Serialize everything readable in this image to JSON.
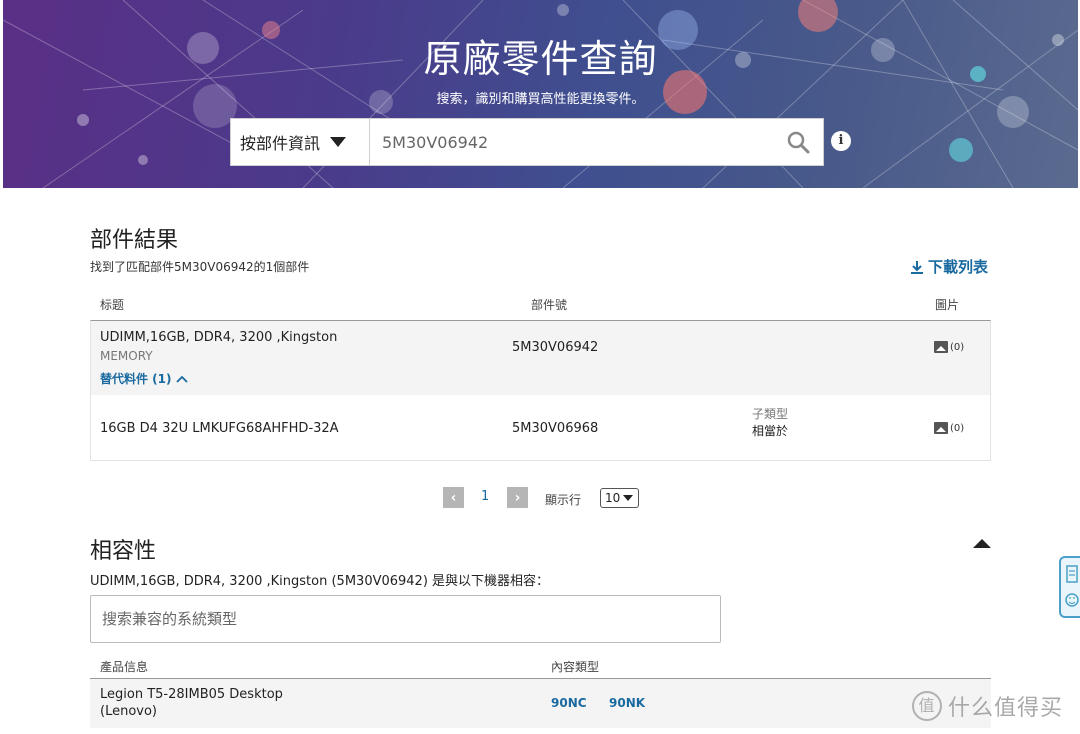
{
  "hero": {
    "title": "原廠零件查詢",
    "subtitle": "搜索，識別和購買高性能更換零件。",
    "search_mode": "按部件資訊",
    "search_value": "5M30V06942",
    "info_symbol": "i"
  },
  "results": {
    "title": "部件結果",
    "summary": "找到了匹配部件5M30V06942的1個部件",
    "download_label": "下載列表",
    "columns": {
      "title": "标题",
      "part_number": "部件號",
      "image": "圖片"
    },
    "rows": [
      {
        "title": "UDIMM,16GB, DDR4, 3200 ,Kingston",
        "category": "MEMORY",
        "alt_label": "替代料件 (1)",
        "part_number": "5M30V06942",
        "image_count": "(0)"
      },
      {
        "title": "16GB D4 32U LMKUFG68AHFHD-32A",
        "part_number": "5M30V06968",
        "subtype_label": "子類型",
        "subtype_value": "相當於",
        "image_count": "(0)"
      }
    ]
  },
  "pagination": {
    "prev": "‹",
    "current_page": "1",
    "next": "›",
    "rows_label": "顯示行",
    "rows_value": "10"
  },
  "compatibility": {
    "title": "相容性",
    "description": "UDIMM,16GB, DDR4, 3200 ,Kingston (5M30V06942) 是與以下機器相容：",
    "search_placeholder": "搜索兼容的系統類型",
    "columns": {
      "product": "產品信息",
      "content_type": "內容類型"
    },
    "rows": [
      {
        "product_line1": "Legion T5-28IMB05 Desktop",
        "product_line2": "(Lenovo)",
        "codes": [
          "90NC",
          "90NK"
        ]
      }
    ]
  },
  "watermark": {
    "badge": "值",
    "text": "什么值得买"
  },
  "colors": {
    "link": "#1a6aa0",
    "hero_start": "#5a2f86",
    "hero_end": "#5a6a8f"
  }
}
